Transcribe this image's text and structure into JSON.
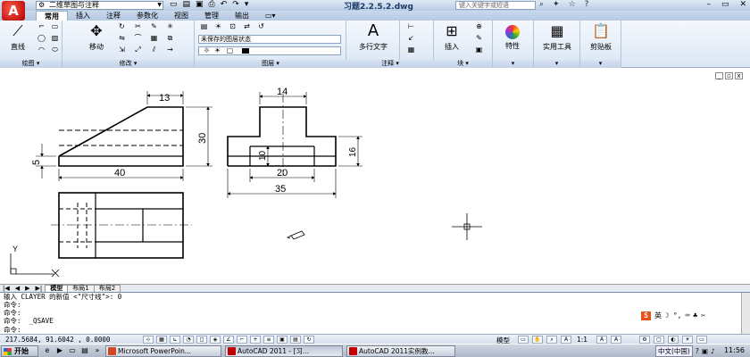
{
  "titlebar": {
    "workspace": "二维草图与注释",
    "document_title": "习题2.2.5.2.dwg",
    "search_placeholder": "键入关键字或短语"
  },
  "ribbon_tabs": [
    "常用",
    "插入",
    "注释",
    "参数化",
    "视图",
    "管理",
    "输出"
  ],
  "ribbon": {
    "draw_big_label": "直线",
    "draw_panel": "绘图",
    "modify_big_label": "移动",
    "modify_panel": "修改",
    "layer_state": "未保存的图层状态",
    "current_layer": "0",
    "layer_panel": "图层",
    "mtext_label": "多行文字",
    "annotation_panel": "注释",
    "insert_label": "插入",
    "block_panel": "块",
    "properties_label": "特性",
    "utilities_label": "实用工具",
    "clipboard_label": "剪贴板"
  },
  "drawing": {
    "dims": {
      "d13": "13",
      "d30": "30",
      "d5": "5",
      "d40": "40",
      "d14": "14",
      "d10": "10",
      "d16": "16",
      "d20": "20",
      "d35": "35"
    },
    "ucs_y": "Y",
    "ucs_x": "X"
  },
  "layout_tabs": [
    "模型",
    "布局1",
    "布局2"
  ],
  "command": {
    "lines": [
      "输入 CLAYER 的新值 <\"尺寸线\">: 0",
      "命令:",
      "命令:",
      "命令:  _QSAVE",
      "命令:"
    ],
    "ime_label": "英"
  },
  "status": {
    "coords": "217.5684, 91.6042 , 0.0000",
    "model": "模型",
    "scale": "1:1"
  },
  "taskbar": {
    "start": "开始",
    "tasks": [
      "Microsoft PowerPoin...",
      "AutoCAD 2011 - [习...",
      "AutoCAD 2011实例教..."
    ],
    "ime": "中文(中国)",
    "clock": "11:56"
  },
  "colors": {
    "title_bg": "#c6d7ed",
    "ribbon_bg": "#e4ecf7",
    "autocad_red": "#c00000"
  }
}
